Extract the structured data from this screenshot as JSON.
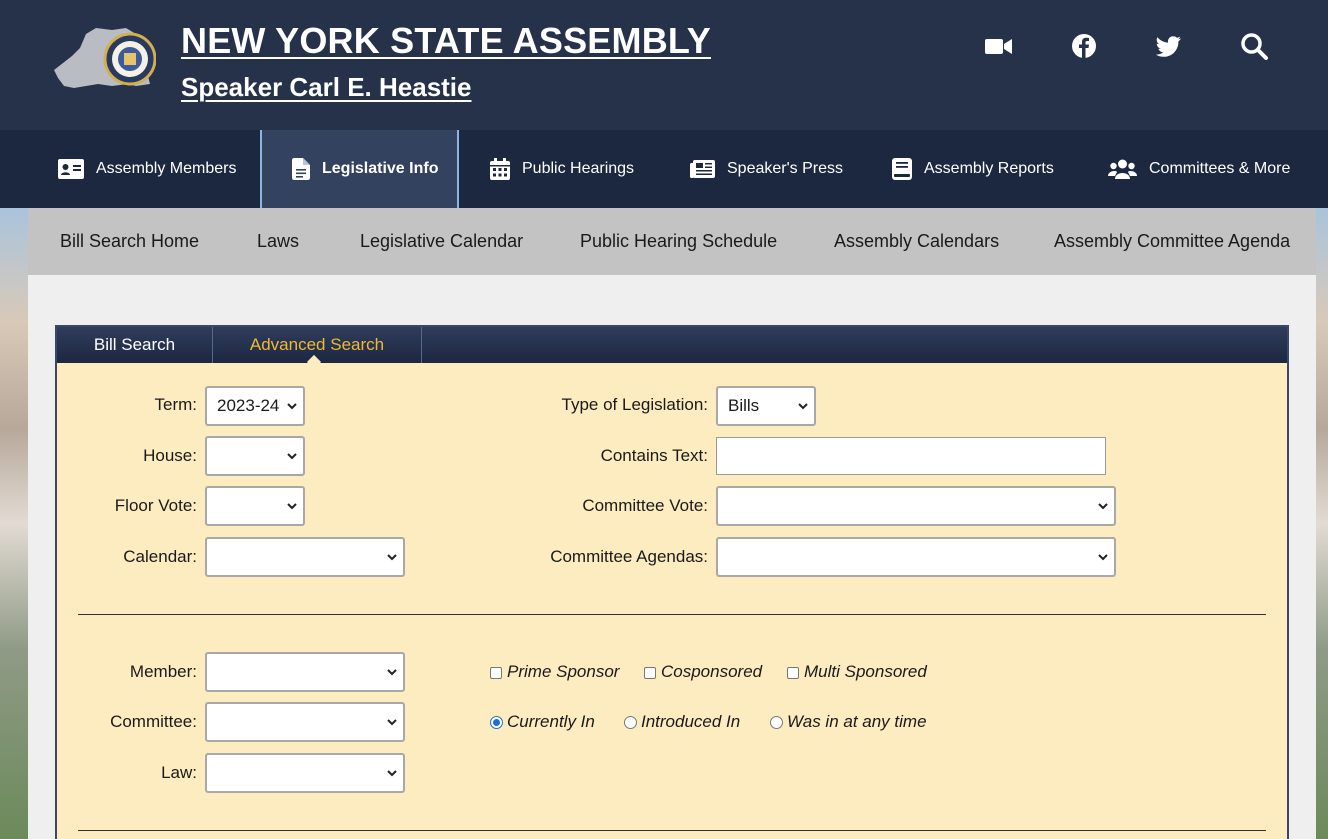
{
  "header": {
    "title": "NEW YORK STATE ASSEMBLY",
    "subtitle": "Speaker Carl E. Heastie",
    "icons": [
      "video-icon",
      "facebook-icon",
      "twitter-icon",
      "search-icon"
    ]
  },
  "mainnav": {
    "items": [
      {
        "label": "Assembly Members",
        "icon": "id-card-icon"
      },
      {
        "label": "Legislative Info",
        "icon": "document-icon",
        "active": true
      },
      {
        "label": "Public Hearings",
        "icon": "calendar-icon"
      },
      {
        "label": "Speaker's Press",
        "icon": "newspaper-icon"
      },
      {
        "label": "Assembly Reports",
        "icon": "book-icon"
      },
      {
        "label": "Committees & More",
        "icon": "users-icon"
      }
    ]
  },
  "subnav": {
    "items": [
      "Bill Search Home",
      "Laws",
      "Legislative Calendar",
      "Public Hearing Schedule",
      "Assembly Calendars",
      "Assembly Committee Agenda"
    ]
  },
  "tabs": {
    "bill_search": "Bill Search",
    "advanced_search": "Advanced Search",
    "active": "Advanced Search"
  },
  "form": {
    "term": {
      "label": "Term:",
      "value": "2023-24"
    },
    "house": {
      "label": "House:",
      "value": ""
    },
    "floor_vote": {
      "label": "Floor Vote:",
      "value": ""
    },
    "calendar": {
      "label": "Calendar:",
      "value": ""
    },
    "type": {
      "label": "Type of Legislation:",
      "value": "Bills"
    },
    "contains_text": {
      "label": "Contains Text:",
      "value": ""
    },
    "committee_vote": {
      "label": "Committee Vote:",
      "value": ""
    },
    "committee_agendas": {
      "label": "Committee Agendas:",
      "value": ""
    },
    "member": {
      "label": "Member:",
      "value": ""
    },
    "committee": {
      "label": "Committee:",
      "value": ""
    },
    "law": {
      "label": "Law:",
      "value": ""
    },
    "sponsor_options": [
      {
        "label": "Prime Sponsor",
        "checked": false
      },
      {
        "label": "Cosponsored",
        "checked": false
      },
      {
        "label": "Multi Sponsored",
        "checked": false
      }
    ],
    "committee_options": [
      {
        "label": "Currently In",
        "selected": true
      },
      {
        "label": "Introduced In",
        "selected": false
      },
      {
        "label": "Was in at any time",
        "selected": false
      }
    ]
  },
  "colors": {
    "header_bg": "#26314a",
    "nav_bg": "#1c2740",
    "panel_bg": "#fdecc0",
    "active_tab": "#f0b833"
  }
}
